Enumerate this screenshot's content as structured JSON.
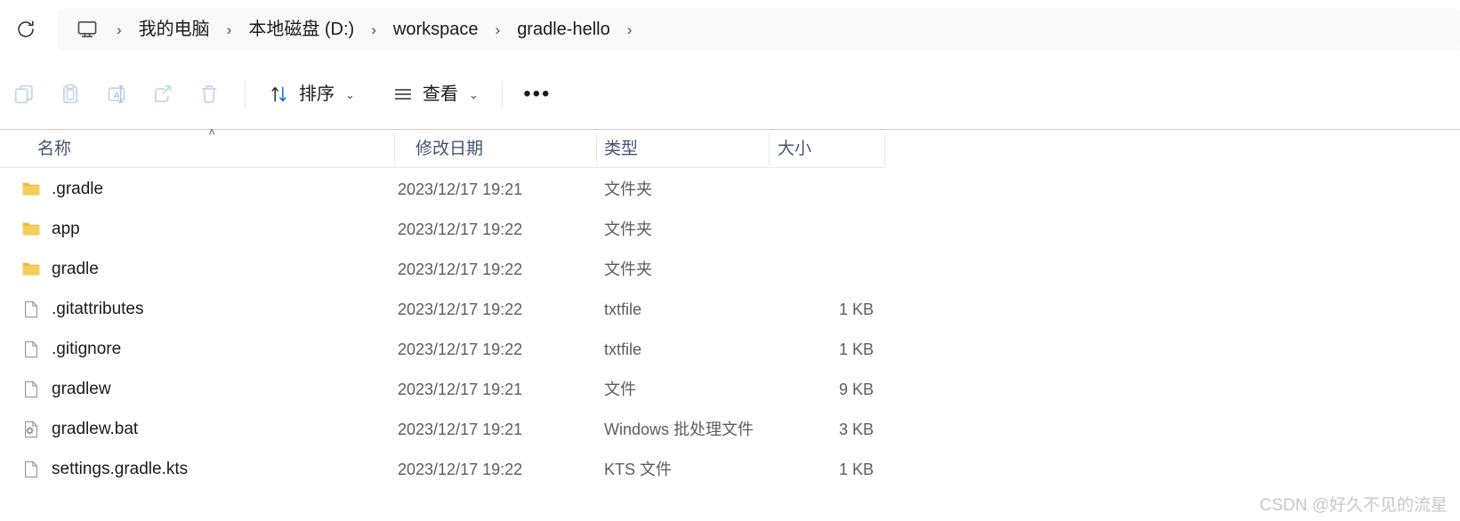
{
  "address_bar": {
    "refresh_icon": "refresh-icon",
    "root_icon": "monitor-icon",
    "separator": "›",
    "crumbs": [
      {
        "label": "我的电脑"
      },
      {
        "label": "本地磁盘 (D:)"
      },
      {
        "label": "workspace"
      },
      {
        "label": "gradle-hello"
      }
    ]
  },
  "toolbar": {
    "icon_buttons": [
      {
        "name": "copy-icon",
        "label": "复制"
      },
      {
        "name": "paste-icon",
        "label": "粘贴"
      },
      {
        "name": "rename-icon",
        "label": "重命名"
      },
      {
        "name": "share-icon",
        "label": "共享"
      },
      {
        "name": "delete-icon",
        "label": "删除"
      }
    ],
    "sort_label": "排序",
    "sort_icon": "sort-arrows-icon",
    "view_label": "查看",
    "view_icon": "view-lines-icon",
    "chevron": "⌄",
    "overflow_label": "•••"
  },
  "columns": {
    "name": "名称",
    "date_modified": "修改日期",
    "type": "类型",
    "size": "大小",
    "sort_indicator": "˄",
    "sort_direction": "ascending",
    "sorted_by": "名称"
  },
  "files": [
    {
      "name": ".gradle",
      "date": "2023/12/17 19:21",
      "type": "文件夹",
      "size": "",
      "icon": "folder-icon"
    },
    {
      "name": "app",
      "date": "2023/12/17 19:22",
      "type": "文件夹",
      "size": "",
      "icon": "folder-icon"
    },
    {
      "name": "gradle",
      "date": "2023/12/17 19:22",
      "type": "文件夹",
      "size": "",
      "icon": "folder-icon"
    },
    {
      "name": ".gitattributes",
      "date": "2023/12/17 19:22",
      "type": "txtfile",
      "size": "1 KB",
      "icon": "document-icon"
    },
    {
      "name": ".gitignore",
      "date": "2023/12/17 19:22",
      "type": "txtfile",
      "size": "1 KB",
      "icon": "document-icon"
    },
    {
      "name": "gradlew",
      "date": "2023/12/17 19:21",
      "type": "文件",
      "size": "9 KB",
      "icon": "document-icon"
    },
    {
      "name": "gradlew.bat",
      "date": "2023/12/17 19:21",
      "type": "Windows 批处理文件",
      "size": "3 KB",
      "icon": "batch-file-icon"
    },
    {
      "name": "settings.gradle.kts",
      "date": "2023/12/17 19:22",
      "type": "KTS 文件",
      "size": "1 KB",
      "icon": "document-icon"
    }
  ],
  "watermark": "CSDN @好久不见的流星",
  "colors": {
    "folder": "#f7ce5b",
    "folder_shade": "#f0bd3f",
    "accent_blue": "#1668d0",
    "header_text": "#44546f",
    "meta_text": "#5d5d5d",
    "address_bg": "#f9f9f9",
    "disabled_icon": "#c3d4e8",
    "watermark": "#c9c9c9"
  }
}
